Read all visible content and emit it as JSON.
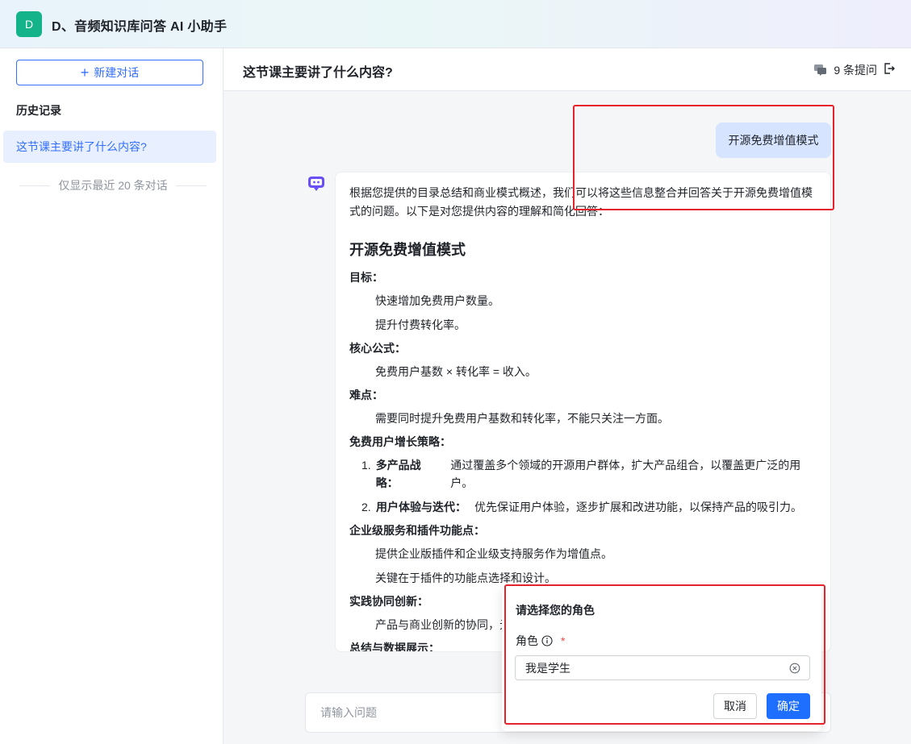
{
  "header": {
    "logo_letter": "D",
    "title": "D、音频知识库问答 AI 小助手"
  },
  "sidebar": {
    "new_chat_label": "新建对话",
    "history_title": "历史记录",
    "items": [
      {
        "label": "这节课主要讲了什么内容?"
      }
    ],
    "note": "仅显示最近 20 条对话"
  },
  "main": {
    "title": "这节课主要讲了什么内容?",
    "question_count": "9 条提问",
    "user_message": "开源免费增值模式",
    "answer": {
      "intro": "根据您提供的目录总结和商业模式概述，我们可以将这些信息整合并回答关于开源免费增值模式的问题。以下是对您提供内容的理解和简化回答：",
      "heading": "开源免费增值模式",
      "sections": [
        {
          "title": "目标：",
          "lines": [
            "快速增加免费用户数量。",
            "提升付费转化率。"
          ]
        },
        {
          "title": "核心公式：",
          "lines": [
            "免费用户基数 × 转化率 = 收入。"
          ]
        },
        {
          "title": "难点：",
          "lines": [
            "需要同时提升免费用户基数和转化率，不能只关注一方面。"
          ]
        },
        {
          "title": "免费用户增长策略：",
          "ordered": [
            {
              "num": "1.",
              "label": "多产品战略：",
              "text": "通过覆盖多个领域的开源用户群体，扩大产品组合，以覆盖更广泛的用户。"
            },
            {
              "num": "2.",
              "label": "用户体验与迭代：",
              "text": "优先保证用户体验，逐步扩展和改进功能，以保持产品的吸引力。"
            }
          ]
        },
        {
          "title": "企业级服务和插件功能点：",
          "lines": [
            "提供企业版插件和企业级支持服务作为增值点。",
            "关键在于插件的功能点选择和设计。"
          ]
        },
        {
          "title": "实践协同创新：",
          "lines": [
            "产品与商业创新的协同，元"
          ]
        },
        {
          "title": "总结与数据展示：",
          "lines": []
        }
      ]
    },
    "input_placeholder": "请输入问题"
  },
  "role_dialog": {
    "title": "请选择您的角色",
    "field_label": "角色",
    "selected_value": "我是学生",
    "cancel_label": "取消",
    "confirm_label": "确定"
  },
  "colors": {
    "accent": "#3370ff",
    "logo": "#14b38a",
    "annotation": "#e8222b",
    "confirm": "#1f6fff"
  }
}
